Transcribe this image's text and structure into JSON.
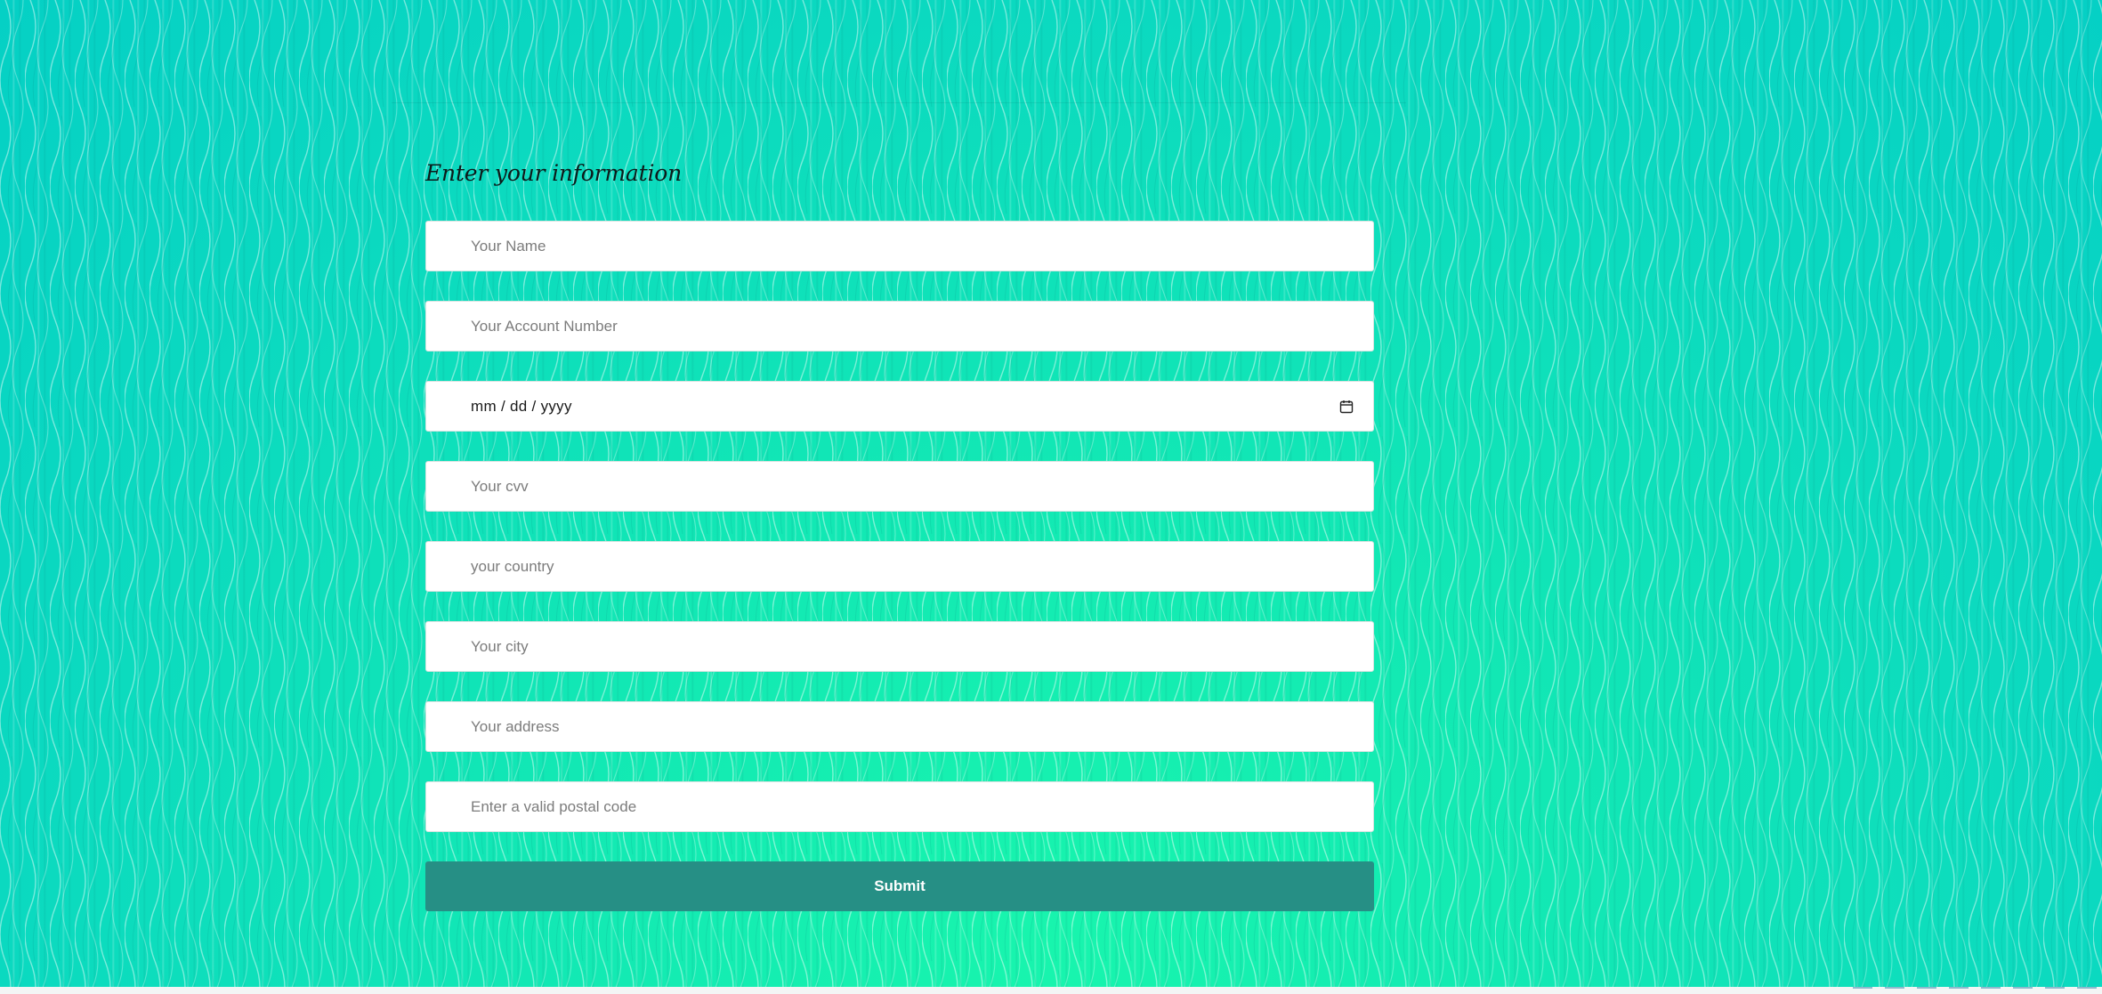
{
  "form": {
    "title": "Enter your information",
    "fields": [
      {
        "name": "name",
        "placeholder": "Your Name"
      },
      {
        "name": "account-number",
        "placeholder": "Your Account Number"
      },
      {
        "name": "date",
        "value": "mm / dd / yyyy",
        "icon": "calendar-icon"
      },
      {
        "name": "cvv",
        "placeholder": "Your cvv"
      },
      {
        "name": "country",
        "placeholder": "your country"
      },
      {
        "name": "city",
        "placeholder": "Your city"
      },
      {
        "name": "address",
        "placeholder": "Your address"
      },
      {
        "name": "postal-code",
        "placeholder": "Enter a valid postal code"
      }
    ],
    "submit_label": "Submit"
  },
  "colors": {
    "background": "#12e8b4",
    "submit_button": "#268f85",
    "field_background": "#ffffff",
    "placeholder_text": "#7c7c7c"
  }
}
